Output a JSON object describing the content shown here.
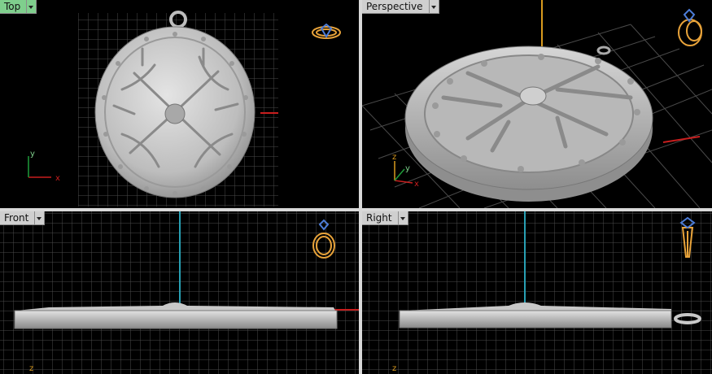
{
  "viewports": {
    "top": {
      "label": "Top"
    },
    "perspective": {
      "label": "Perspective"
    },
    "front": {
      "label": "Front"
    },
    "right": {
      "label": "Right"
    }
  },
  "axes": {
    "x": "x",
    "y": "y",
    "z": "z"
  },
  "colors": {
    "active_tab": "#7fcf8d",
    "inactive_tab": "#cfcfcf",
    "grid": "#4a4a4a",
    "x_axis": "#c81e1e",
    "y_axis": "#1f9c3a",
    "z_axis_orange": "#d99a1e",
    "z_axis_teal": "#28a0b4",
    "model": "#bdbdbd",
    "gizmo": "#e8a33a"
  },
  "icons": [
    "ring-gizmo-icon",
    "pendant-gizmo-icon",
    "dropdown-arrow-icon"
  ]
}
